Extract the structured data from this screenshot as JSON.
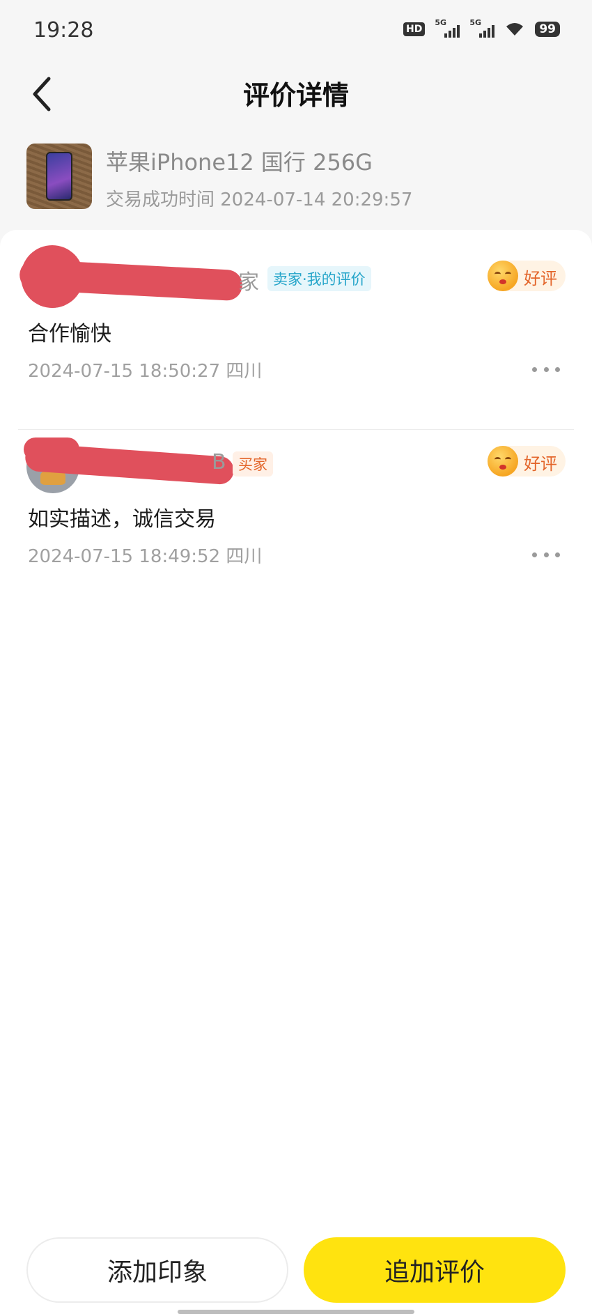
{
  "status_bar": {
    "time": "19:28",
    "hd_label": "HD",
    "signal1_label": "5G",
    "signal2_label": "5G",
    "battery": "99"
  },
  "header": {
    "title": "评价详情"
  },
  "product": {
    "name": "苹果iPhone12 国行 256G",
    "trade_time": "交易成功时间 2024-07-14 20:29:57"
  },
  "reviews": [
    {
      "username_suffix": "家",
      "role_tag": "卖家·我的评价",
      "rating": "好评",
      "text": "合作愉快",
      "meta": "2024-07-15 18:50:27  四川"
    },
    {
      "username_suffix": "B",
      "role_tag": "买家",
      "rating": "好评",
      "text": "如实描述，诚信交易",
      "meta": "2024-07-15 18:49:52  四川"
    }
  ],
  "bottom_bar": {
    "left_button": "添加印象",
    "right_button": "追加评价"
  },
  "colors": {
    "accent_yellow": "#ffe30f",
    "seller_tag": "#23a4c9",
    "buyer_tag": "#e3652a",
    "redaction": "#e0505c"
  }
}
